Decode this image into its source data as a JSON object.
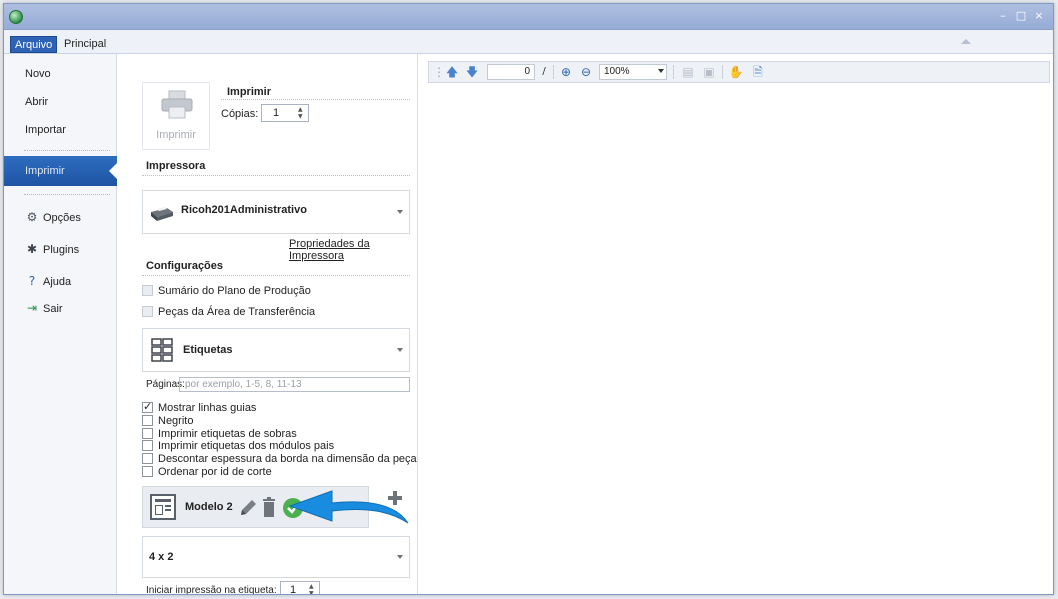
{
  "menu": {
    "tabs": [
      {
        "label": "Arquivo",
        "active": true
      },
      {
        "label": "Principal",
        "active": false
      }
    ]
  },
  "window_controls": {
    "minimize": "–",
    "maximize": "□",
    "close": "×"
  },
  "sidebar": {
    "items": [
      {
        "label": "Novo"
      },
      {
        "label": "Abrir"
      },
      {
        "label": "Importar"
      },
      {
        "label": "Imprimir",
        "active": true
      },
      {
        "label": "Opções",
        "icon": "gear-icon"
      },
      {
        "label": "Plugins",
        "icon": "puzzle-icon"
      },
      {
        "label": "Ajuda",
        "icon": "help-icon"
      },
      {
        "label": "Sair",
        "icon": "exit-icon"
      }
    ]
  },
  "print": {
    "button_label": "Imprimir",
    "title": "Imprimir",
    "copies_label": "Cópias:",
    "copies_value": "1"
  },
  "printer": {
    "section_title": "Impressora",
    "name": "Ricoh201Administrativo",
    "properties_link": "Propriedades da Impressora"
  },
  "settings": {
    "section_title": "Configurações",
    "options_disabled": [
      {
        "label": "Sumário do Plano de Produção",
        "checked": false
      },
      {
        "label": "Peças da Área de Transferência",
        "checked": false
      }
    ],
    "layout_value": "Etiquetas",
    "pages_label": "Páginas:",
    "pages_placeholder": "por exemplo, 1-5, 8, 11-13",
    "options": [
      {
        "label": "Mostrar linhas guias",
        "checked": true
      },
      {
        "label": "Negrito",
        "checked": false
      },
      {
        "label": "Imprimir etiquetas de sobras",
        "checked": false
      },
      {
        "label": "Imprimir etiquetas dos módulos pais",
        "checked": false
      },
      {
        "label": "Descontar espessura da borda na dimensão da peça",
        "checked": false
      },
      {
        "label": "Ordenar por id de corte",
        "checked": false
      }
    ],
    "model_name": "Modelo 2",
    "size_value": "4 x 2",
    "start_label": "Iniciar impressão na etiqueta:",
    "start_value": "1"
  },
  "viewer_toolbar": {
    "page_value": "0",
    "page_separator": "/",
    "zoom_value": "100%"
  },
  "colors": {
    "accent": "#2d62b5",
    "arrow": "#1a8ce0",
    "check_green": "#4caf50"
  }
}
